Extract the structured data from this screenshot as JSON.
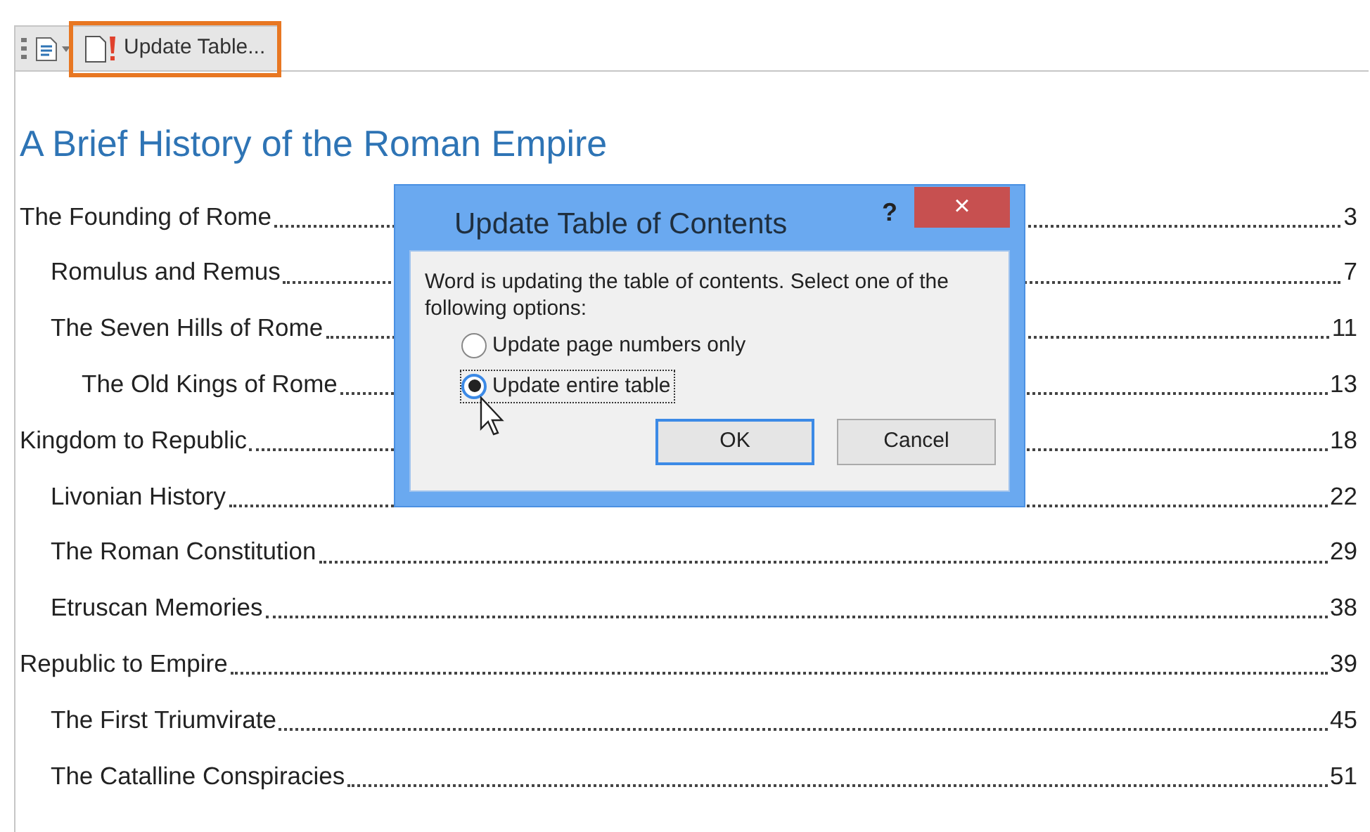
{
  "toolbar": {
    "update_button": "Update Table..."
  },
  "document": {
    "heading": "A Brief History of the Roman Empire",
    "toc": [
      {
        "title": "The Founding of Rome",
        "page": "3",
        "children": [
          {
            "title": "Romulus and Remus",
            "page": "7"
          },
          {
            "title": "The Seven Hills of Rome",
            "page": "11",
            "children": [
              {
                "title": "The Old Kings of Rome",
                "page": "13"
              }
            ]
          }
        ]
      },
      {
        "title": "Kingdom to Republic",
        "page": "18",
        "children": [
          {
            "title": "Livonian History",
            "page": "22"
          },
          {
            "title": "The Roman Constitution",
            "page": "29"
          },
          {
            "title": "Etruscan Memories",
            "page": "38"
          }
        ]
      },
      {
        "title": "Republic to Empire",
        "page": "39",
        "children": [
          {
            "title": "The First Triumvirate",
            "page": "45"
          },
          {
            "title": "The Catalline Conspiracies",
            "page": "51"
          }
        ]
      }
    ]
  },
  "dialog": {
    "title": "Update Table of Contents",
    "help": "?",
    "close": "×",
    "message": "Word is updating the table of contents.  Select one of the following options:",
    "options": [
      {
        "label": "Update page numbers only",
        "selected": false
      },
      {
        "label": "Update entire table",
        "selected": true
      }
    ],
    "buttons": [
      "OK",
      "Cancel"
    ]
  }
}
